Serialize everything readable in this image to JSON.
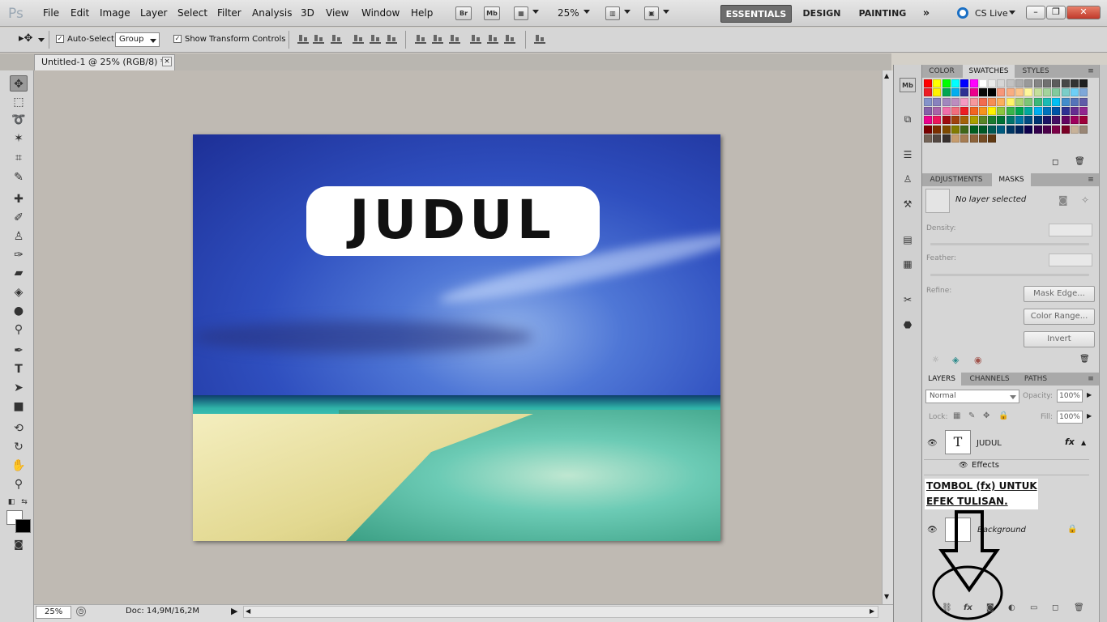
{
  "app": {
    "logo": "Ps"
  },
  "menu": [
    "File",
    "Edit",
    "Image",
    "Layer",
    "Select",
    "Filter",
    "Analysis",
    "3D",
    "View",
    "Window",
    "Help"
  ],
  "appbar": {
    "bridge": "Br",
    "minibridge": "Mb",
    "zoom": "25%"
  },
  "workspaces": {
    "essentials": "ESSENTIALS",
    "design": "DESIGN",
    "painting": "PAINTING",
    "more": "»"
  },
  "cslive": "CS Live",
  "options": {
    "auto_select_label": "Auto-Select:",
    "auto_select_value": "Group",
    "transform_label": "Show Transform Controls"
  },
  "document": {
    "tab_title": "Untitled-1 @ 25% (RGB/8) *",
    "close": "×",
    "text_layer_content": "JUDUL"
  },
  "status": {
    "zoom": "25%",
    "doc_info": "Doc: 14,9M/16,2M"
  },
  "panels": {
    "color_group": {
      "tabs": [
        "COLOR",
        "SWATCHES",
        "STYLES"
      ],
      "active": "SWATCHES"
    },
    "adjust_group": {
      "tabs": [
        "ADJUSTMENTS",
        "MASKS"
      ],
      "active": "MASKS"
    },
    "masks": {
      "no_layer": "No layer selected",
      "density": "Density:",
      "feather": "Feather:",
      "refine": "Refine:",
      "buttons": [
        "Mask Edge...",
        "Color Range...",
        "Invert"
      ]
    },
    "layers_group": {
      "tabs": [
        "LAYERS",
        "CHANNELS",
        "PATHS"
      ],
      "active": "LAYERS"
    },
    "layers": {
      "blend_mode": "Normal",
      "opacity_label": "Opacity:",
      "opacity": "100%",
      "lock_label": "Lock:",
      "fill_label": "Fill:",
      "fill": "100%",
      "items": [
        {
          "name": "JUDUL",
          "thumb": "T",
          "fx": "fx",
          "effects_label": "Effects"
        },
        {
          "name": "Background"
        }
      ]
    }
  },
  "annotation": {
    "line1": "TOMBOL (fx) UNTUK",
    "line2": "EFEK TULISAN."
  },
  "colors": {
    "accent_workspace": "#6d6d6d",
    "close_button": "#c0392b"
  },
  "swatches": [
    "#ff0000",
    "#ffff00",
    "#00ff00",
    "#00ffff",
    "#0000ff",
    "#ff00ff",
    "#ffffff",
    "#ebebeb",
    "#d6d6d6",
    "#c2c2c2",
    "#adadad",
    "#999999",
    "#858585",
    "#707070",
    "#5c5c5c",
    "#474747",
    "#333333",
    "#1f1f1f",
    "#ed1c24",
    "#fff200",
    "#00a651",
    "#00aeef",
    "#2e3192",
    "#ec008c",
    "#0a0a0a",
    "#000000",
    "#f7977a",
    "#f9ad81",
    "#fdc68a",
    "#fff79a",
    "#c4df9b",
    "#a3d39c",
    "#82ca9d",
    "#7bcdc8",
    "#6ecff6",
    "#7ea7d8",
    "#8493ca",
    "#8882be",
    "#a187be",
    "#bc8dbf",
    "#f49ac2",
    "#f6989d",
    "#f26c4f",
    "#f68e55",
    "#fbaf5c",
    "#fff467",
    "#acd372",
    "#7cc576",
    "#3bb878",
    "#1abbb4",
    "#00bff3",
    "#438ccb",
    "#5574b9",
    "#605ca8",
    "#8560a8",
    "#a864a8",
    "#f06eaa",
    "#f26d7d",
    "#ed1c24",
    "#f26522",
    "#f7941d",
    "#fff200",
    "#8dc63f",
    "#39b54a",
    "#00a651",
    "#00a99d",
    "#00aeef",
    "#0072bc",
    "#0054a6",
    "#2e3192",
    "#662d91",
    "#92278f",
    "#ec008c",
    "#ed145b",
    "#9e0b0f",
    "#a0410d",
    "#a36209",
    "#aba000",
    "#598527",
    "#1a7b30",
    "#007236",
    "#00746b",
    "#0076a3",
    "#004b80",
    "#003471",
    "#1b1464",
    "#440e62",
    "#630460",
    "#9e005d",
    "#9e0039",
    "#790000",
    "#7b2e00",
    "#7d4900",
    "#827b00",
    "#406618",
    "#005e20",
    "#005826",
    "#005952",
    "#005b7f",
    "#003663",
    "#002157",
    "#0d004c",
    "#32004b",
    "#4b0049",
    "#7b0046",
    "#7a0026",
    "#c7b299",
    "#998675",
    "#736357",
    "#534741",
    "#37302d",
    "#c69c6d",
    "#a67c52",
    "#8c6239",
    "#754c24",
    "#603913"
  ]
}
